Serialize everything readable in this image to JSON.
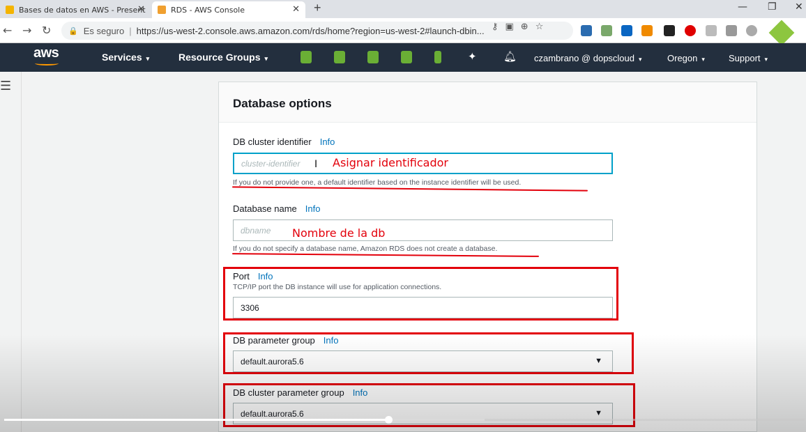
{
  "browser": {
    "tabs": [
      {
        "title": "Bases de datos en AWS - Present",
        "favicon_color": "#f4b400"
      },
      {
        "title": "RDS - AWS Console",
        "favicon_color": "#f0a030"
      }
    ],
    "address": {
      "secure_label": "Es seguro",
      "url": "https://us-west-2.console.aws.amazon.com/rds/home?region=us-west-2#launch-dbin..."
    }
  },
  "aws_nav": {
    "logo": "aws",
    "services": "Services",
    "resource_groups": "Resource Groups",
    "account": "czambrano @ dopscloud",
    "region": "Oregon",
    "support": "Support",
    "dropdown_glyph": "▾"
  },
  "panel": {
    "title": "Database options",
    "info_label": "Info",
    "cluster_identifier": {
      "label": "DB cluster identifier",
      "placeholder": "cluster-identifier",
      "hint": "If you do not provide one, a default identifier based on the instance identifier will be used."
    },
    "database_name": {
      "label": "Database name",
      "placeholder": "dbname",
      "hint": "If you do not specify a database name, Amazon RDS does not create a database."
    },
    "port": {
      "label": "Port",
      "hint": "TCP/IP port the DB instance will use for application connections.",
      "value": "3306"
    },
    "db_parameter_group": {
      "label": "DB parameter group",
      "value": "default.aurora5.6"
    },
    "db_cluster_parameter_group": {
      "label": "DB cluster parameter group",
      "value": "default.aurora5.6"
    }
  },
  "annotations": {
    "identifier_note": "Asignar identificador",
    "dbname_note": "Nombre de la db",
    "color": "#e3000b"
  },
  "video": {
    "played_fraction": 0.48,
    "buffered_fraction": 0.6
  }
}
